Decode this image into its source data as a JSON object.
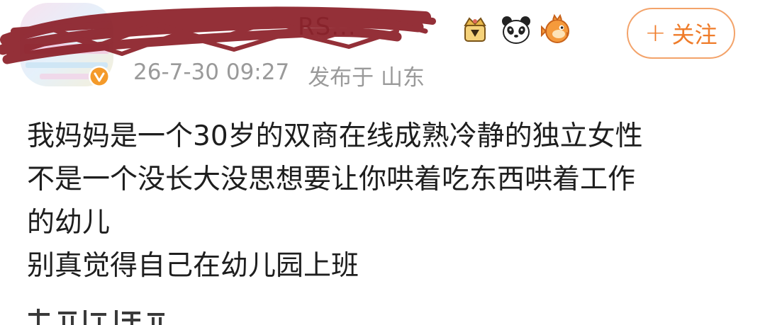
{
  "post": {
    "author": {
      "name_visible_fragment": "RS...",
      "verified": true
    },
    "follow_button": {
      "icon": "+",
      "label": "关注"
    },
    "timestamp": "26-7-30 09:27",
    "location_label": "发布于 山东",
    "content_lines": [
      "我妈妈是一个30岁的双商在线成熟冷静的独立女性",
      "不是一个没长大没思想要让你哄着吃东西哄着工作",
      "的幼儿",
      "别真觉得自己在幼儿园上班"
    ],
    "cut_off_text": "",
    "badges": [
      "crown-badge-icon",
      "panda-icon",
      "pufferfish-icon"
    ],
    "colors": {
      "accent": "#ef7c2a",
      "scribble": "#8b1f28",
      "verified": "#f49a2a"
    }
  }
}
